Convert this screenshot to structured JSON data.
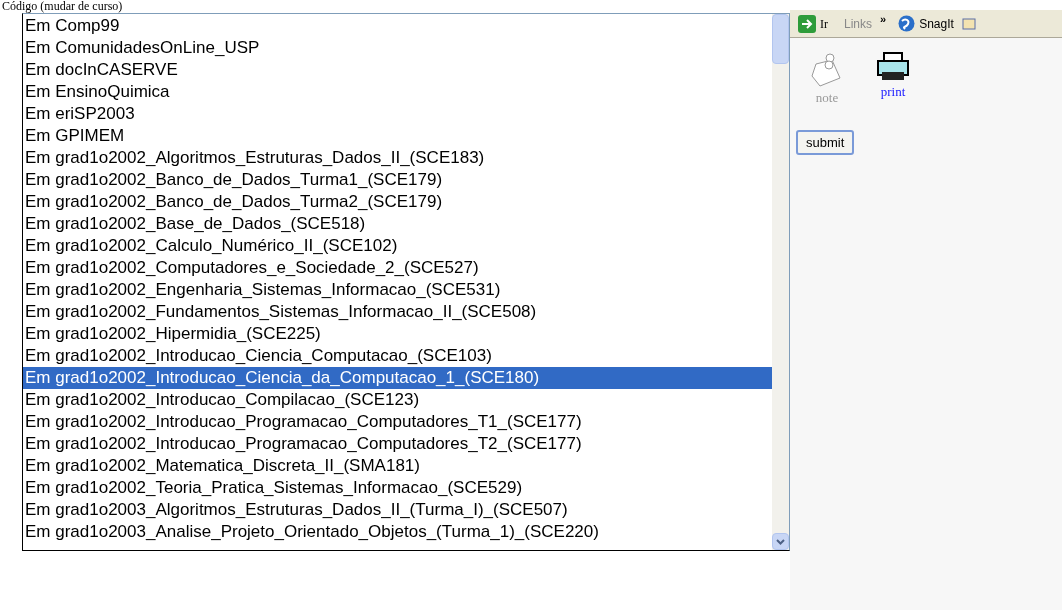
{
  "page_title": "Código (mudar de curso)",
  "toolbar": {
    "go_label": "Ir",
    "links_label": "Links",
    "chevron": "»",
    "snagit_label": "SnagIt"
  },
  "list": {
    "items": [
      {
        "label": "Em Comp99",
        "selected": false
      },
      {
        "label": "Em ComunidadesOnLine_USP",
        "selected": false
      },
      {
        "label": "Em docInCASERVE",
        "selected": false
      },
      {
        "label": "Em EnsinoQuimica",
        "selected": false
      },
      {
        "label": "Em eriSP2003",
        "selected": false
      },
      {
        "label": "Em GPIMEM",
        "selected": false
      },
      {
        "label": "Em grad1o2002_Algoritmos_Estruturas_Dados_II_(SCE183)",
        "selected": false
      },
      {
        "label": "Em grad1o2002_Banco_de_Dados_Turma1_(SCE179)",
        "selected": false
      },
      {
        "label": "Em grad1o2002_Banco_de_Dados_Turma2_(SCE179)",
        "selected": false
      },
      {
        "label": "Em grad1o2002_Base_de_Dados_(SCE518)",
        "selected": false
      },
      {
        "label": "Em grad1o2002_Calculo_Numérico_II_(SCE102)",
        "selected": false
      },
      {
        "label": "Em grad1o2002_Computadores_e_Sociedade_2_(SCE527)",
        "selected": false
      },
      {
        "label": "Em grad1o2002_Engenharia_Sistemas_Informacao_(SCE531)",
        "selected": false
      },
      {
        "label": "Em grad1o2002_Fundamentos_Sistemas_Informacao_II_(SCE508)",
        "selected": false
      },
      {
        "label": "Em grad1o2002_Hipermidia_(SCE225)",
        "selected": false
      },
      {
        "label": "Em grad1o2002_Introducao_Ciencia_Computacao_(SCE103)",
        "selected": false
      },
      {
        "label": "Em grad1o2002_Introducao_Ciencia_da_Computacao_1_(SCE180)",
        "selected": true
      },
      {
        "label": "Em grad1o2002_Introducao_Compilacao_(SCE123)",
        "selected": false
      },
      {
        "label": "Em grad1o2002_Introducao_Programacao_Computadores_T1_(SCE177)",
        "selected": false
      },
      {
        "label": "Em grad1o2002_Introducao_Programacao_Computadores_T2_(SCE177)",
        "selected": false
      },
      {
        "label": "Em grad1o2002_Matematica_Discreta_II_(SMA181)",
        "selected": false
      },
      {
        "label": "Em grad1o2002_Teoria_Pratica_Sistemas_Informacao_(SCE529)",
        "selected": false
      },
      {
        "label": "Em grad1o2003_Algoritmos_Estruturas_Dados_II_(Turma_I)_(SCE507)",
        "selected": false
      },
      {
        "label": "Em grad1o2003_Analise_Projeto_Orientado_Objetos_(Turma_1)_(SCE220)",
        "selected": false
      }
    ]
  },
  "tools": [
    {
      "label": "note",
      "kind": "note"
    },
    {
      "label": "print",
      "kind": "print"
    }
  ],
  "submit_label": "submit"
}
